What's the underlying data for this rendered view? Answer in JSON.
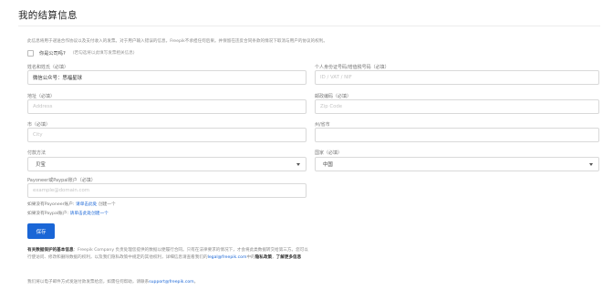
{
  "page": {
    "title": "我的结算信息",
    "description": "此信息将用于递送合作协议以及支付收入的发票。对于用户输入错误的信息，Freepik不承担任何后果。并保留在违反合同条款的情况下取消与用户的协议的权利。"
  },
  "company": {
    "label": "你是公司吗?",
    "hint": "(若勾选将以此填写发票相关信息)"
  },
  "fields": {
    "name": {
      "label": "姓名和姓氏（必填）",
      "value": "微信公众号：思福星球"
    },
    "tax_id": {
      "label": "个人身份证号码/增值税号码（必填）",
      "placeholder": "ID / VAT / NIF"
    },
    "address": {
      "label": "地址（必填）",
      "placeholder": "Address"
    },
    "zip": {
      "label": "邮政编码（必填）",
      "placeholder": "Zip Code"
    },
    "city": {
      "label": "市（必填）",
      "placeholder": "City"
    },
    "province": {
      "label": "州/省市",
      "placeholder": ""
    },
    "payment": {
      "label": "付款方法",
      "value": "贝宝"
    },
    "country": {
      "label": "国家（必填）",
      "value": "中国"
    },
    "payoneer": {
      "label": "Payoneer或Paypal账户（必填）",
      "placeholder": "example@domain.com"
    }
  },
  "notes": {
    "no_payoneer_prefix": "如果没有Payoneer账户:",
    "no_payoneer_link": "请单击此处",
    "no_payoneer_suffix": "创建一个",
    "no_paypal_prefix": "如果没有Paypal账户:",
    "no_paypal_link": "请单击此处创建一个"
  },
  "save_button": "保存",
  "privacy": {
    "heading": "有关数据保护的基本信息",
    "text1": "：Freepik Company 负责处理您提供的数据以便履行合同。只有在法律要求的情况下，",
    "text2": "才会将此类数据转交给第三方。您可以行使访问、修改和删除数据的权利，以及我们隐私政策中规定的其他权利，详细信息请",
    "text3": "查看我们的",
    "link_email": "legal@freepik.com",
    "text4": "中的",
    "link_policy": "隐私政策",
    "text5": "，",
    "link_more": "了解更多信息"
  },
  "footer": {
    "text": "我们将以电子邮件方式发送付款发票给您，如需任何帮助，请联系",
    "email": "support@freepik.com",
    "suffix": "。"
  }
}
